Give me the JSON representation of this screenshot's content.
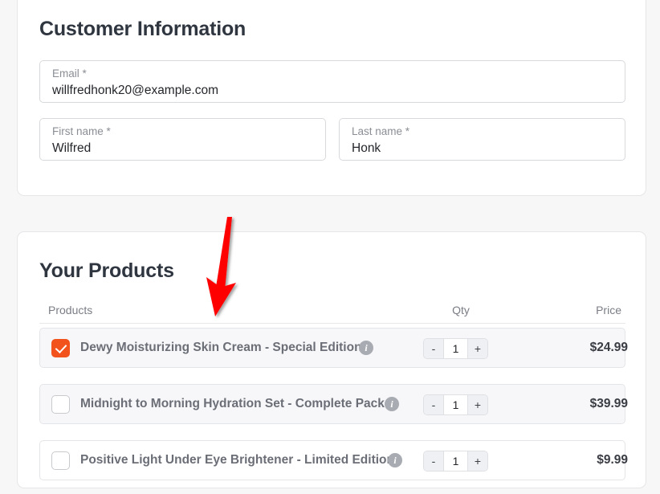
{
  "customer_section": {
    "title": "Customer Information",
    "fields": [
      {
        "label": "Email *",
        "value": "willfredhonk20@example.com"
      },
      {
        "label": "First name *",
        "value": "Wilfred"
      },
      {
        "label": "Last name *",
        "value": "Honk"
      }
    ]
  },
  "products_section": {
    "title": "Your Products",
    "columns": {
      "products": "Products",
      "qty": "Qty",
      "price": "Price"
    },
    "stepper": {
      "decrement_label": "-",
      "increment_label": "+"
    },
    "info_icon_label": "i",
    "rows": [
      {
        "name": "Dewy Moisturizing Skin Cream - Special Edition",
        "qty": "1",
        "price": "$24.99",
        "selected": true
      },
      {
        "name": "Midnight to Morning Hydration Set - Complete Pack",
        "qty": "1",
        "price": "$39.99",
        "selected": false
      },
      {
        "name": "Positive Light Under Eye Brightener - Limited Edition",
        "qty": "1",
        "price": "$9.99",
        "selected": false
      }
    ]
  },
  "annotation": {
    "arrow_color": "#ff0000"
  },
  "colors": {
    "page_background": "#f7f7f8",
    "card_background": "#ffffff",
    "checkbox_checked": "#f2521b",
    "label_text": "#8b8e95",
    "value_text": "#24262b"
  }
}
